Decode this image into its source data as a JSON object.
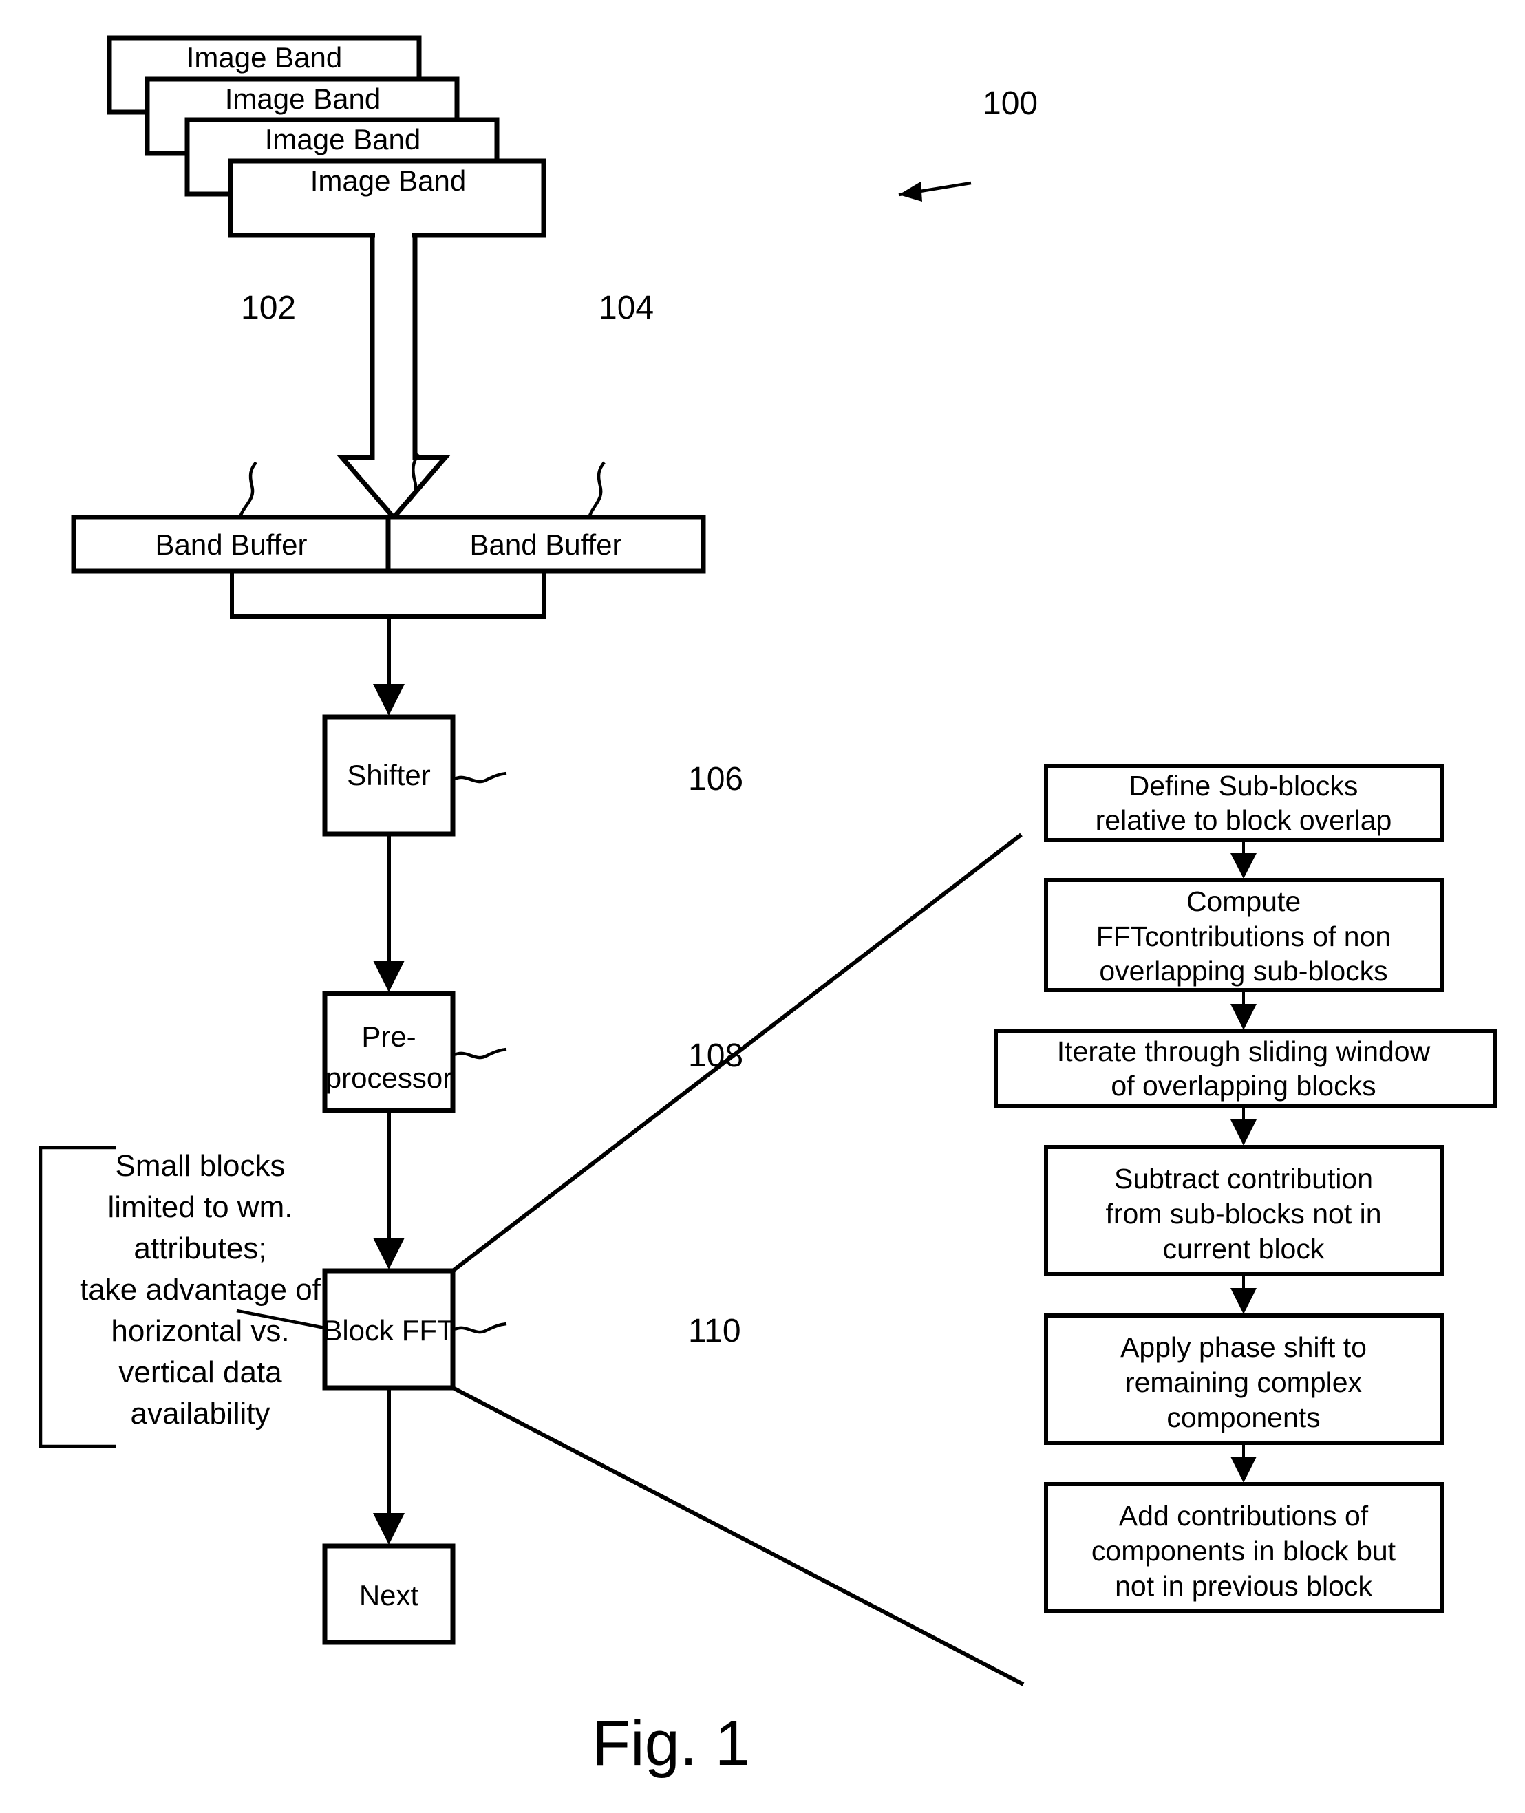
{
  "figure": {
    "caption": "Fig. 1",
    "reference_numerals": {
      "image_bands": "100",
      "band_buffer_left": "102",
      "band_buffer_right": "104",
      "shifter": "106",
      "preprocessor": "108",
      "block_fft": "110"
    }
  },
  "image_bands": {
    "label": "Image Band",
    "stack": [
      {
        "label": "Image Band"
      },
      {
        "label": "Image Band"
      },
      {
        "label": "Image Band"
      },
      {
        "label": "Image Band"
      }
    ]
  },
  "band_buffers": [
    {
      "label": "Band Buffer"
    },
    {
      "label": "Band Buffer"
    }
  ],
  "pipeline": [
    {
      "label": "Shifter",
      "lines": [
        "Shifter"
      ]
    },
    {
      "label": "Pre-processor",
      "lines": [
        "Pre-",
        "processor"
      ]
    },
    {
      "label": "Block FFT",
      "lines": [
        "Block FFT"
      ]
    },
    {
      "label": "Next",
      "lines": [
        "Next"
      ]
    }
  ],
  "annotation": {
    "lines": [
      "Small blocks",
      "limited to wm.",
      "attributes;",
      "take advantage of",
      "horizontal vs.",
      "vertical data",
      "availability"
    ]
  },
  "flowchart": {
    "steps": [
      {
        "id": "define-sub-blocks",
        "lines": [
          "Define Sub-blocks",
          "relative to block overlap"
        ]
      },
      {
        "id": "compute-fft-contributions",
        "lines": [
          "Compute",
          "FFTcontributions of non",
          "overlapping sub-blocks"
        ]
      },
      {
        "id": "iterate-sliding-window",
        "lines": [
          "Iterate through sliding window",
          "of overlapping blocks"
        ]
      },
      {
        "id": "subtract-contribution",
        "lines": [
          "Subtract contribution",
          "from sub-blocks not in",
          "current block"
        ]
      },
      {
        "id": "apply-phase-shift",
        "lines": [
          "Apply phase shift to",
          "remaining complex",
          "components"
        ]
      },
      {
        "id": "add-contributions",
        "lines": [
          "Add contributions of",
          "components in block but",
          "not in previous block"
        ]
      }
    ]
  },
  "colors": {
    "ink": "#000000",
    "paper": "#ffffff"
  }
}
